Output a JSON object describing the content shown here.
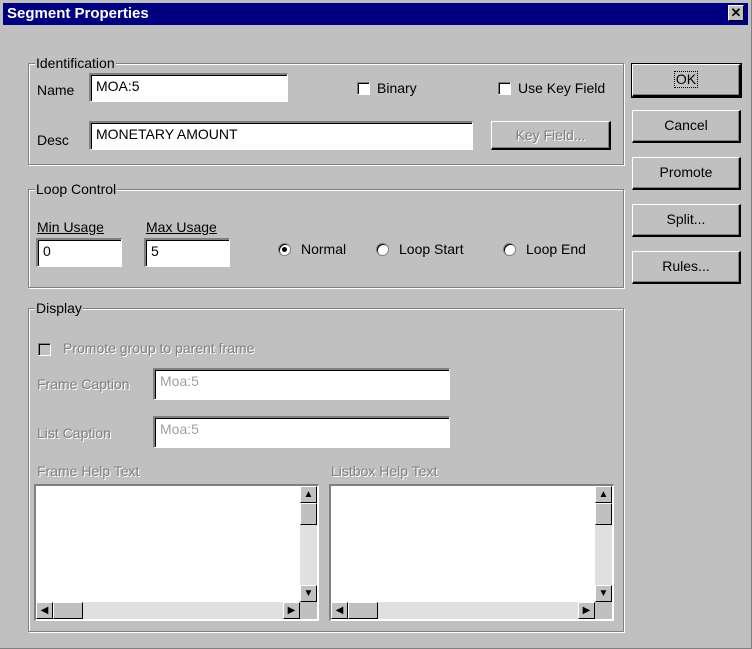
{
  "window": {
    "title": "Segment Properties",
    "close_glyph": "✕"
  },
  "identification": {
    "legend": "Identification",
    "name_label": "Name",
    "name_value": "MOA:5",
    "binary_label": "Binary",
    "binary_checked": false,
    "use_key_field_label": "Use Key Field",
    "use_key_field_checked": false,
    "desc_label": "Desc",
    "desc_value": "MONETARY AMOUNT",
    "key_field_button": "Key Field..."
  },
  "loop_control": {
    "legend": "Loop Control",
    "min_usage_label": "Min Usage",
    "min_usage_value": "0",
    "max_usage_label": "Max Usage",
    "max_usage_value": "5",
    "radio_options": [
      "Normal",
      "Loop Start",
      "Loop End"
    ],
    "selected": "Normal"
  },
  "display": {
    "legend": "Display",
    "promote_group_label": "Promote group to parent frame",
    "frame_caption_label": "Frame Caption",
    "frame_caption_value": "Moa:5",
    "list_caption_label": "List Caption",
    "list_caption_value": "Moa:5",
    "frame_help_label": "Frame Help Text",
    "listbox_help_label": "Listbox Help Text"
  },
  "buttons": {
    "ok": "OK",
    "cancel": "Cancel",
    "promote": "Promote",
    "split": "Split...",
    "rules": "Rules..."
  },
  "icons": {
    "scroll_up": "up-arrow-icon",
    "scroll_down": "down-arrow-icon",
    "scroll_left": "left-arrow-icon",
    "scroll_right": "right-arrow-icon"
  }
}
